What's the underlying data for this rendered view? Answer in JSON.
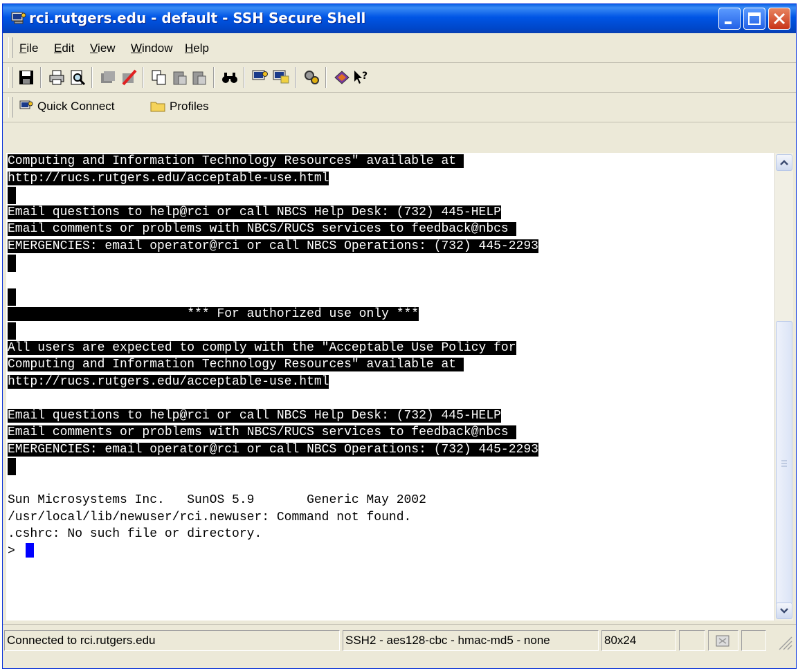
{
  "window": {
    "title": "rci.rutgers.edu - default - SSH Secure Shell"
  },
  "menus": [
    {
      "label": "File",
      "u": "F",
      "rest": "ile"
    },
    {
      "label": "Edit",
      "u": "E",
      "rest": "dit"
    },
    {
      "label": "View",
      "u": "V",
      "rest": "iew"
    },
    {
      "label": "Window",
      "u": "W",
      "rest": "indow"
    },
    {
      "label": "Help",
      "u": "H",
      "rest": "elp"
    }
  ],
  "quickbar": {
    "quick_connect": "Quick Connect",
    "profiles": "Profiles"
  },
  "terminal": {
    "lines": [
      {
        "text": "Computing and Information Technology Resources\" available at ",
        "hl": true
      },
      {
        "text": "http://rucs.rutgers.edu/acceptable-use.html",
        "hl": true
      },
      {
        "text": "",
        "hl": true
      },
      {
        "text": "Email questions to help@rci or call NBCS Help Desk: (732) 445-HELP",
        "hl": true
      },
      {
        "text": "Email comments or problems with NBCS/RUCS services to feedback@nbcs ",
        "hl": true
      },
      {
        "text": "EMERGENCIES: email operator@rci or call NBCS Operations: (732) 445-2293",
        "hl": true
      },
      {
        "text": "",
        "hl": true
      },
      {
        "text": "",
        "hl": false
      },
      {
        "text": "",
        "hl": true
      },
      {
        "text": "                        *** For authorized use only ***",
        "hl": true
      },
      {
        "text": "",
        "hl": true
      },
      {
        "text": "All users are expected to comply with the \"Acceptable Use Policy for",
        "hl": true
      },
      {
        "text": "Computing and Information Technology Resources\" available at ",
        "hl": true
      },
      {
        "text": "http://rucs.rutgers.edu/acceptable-use.html",
        "hl": true
      },
      {
        "text": "",
        "hl": false
      },
      {
        "text": "Email questions to help@rci or call NBCS Help Desk: (732) 445-HELP",
        "hl": true
      },
      {
        "text": "Email comments or problems with NBCS/RUCS services to feedback@nbcs ",
        "hl": true
      },
      {
        "text": "EMERGENCIES: email operator@rci or call NBCS Operations: (732) 445-2293",
        "hl": true
      },
      {
        "text": "",
        "hl": true
      },
      {
        "text": "",
        "hl": false
      },
      {
        "text": "Sun Microsystems Inc.   SunOS 5.9       Generic May 2002",
        "hl": false
      },
      {
        "text": "/usr/local/lib/newuser/rci.newuser: Command not found.",
        "hl": false
      },
      {
        "text": ".cshrc: No such file or directory.",
        "hl": false
      },
      {
        "text": "> ",
        "hl": false,
        "cursor": true
      }
    ]
  },
  "statusbar": {
    "connection": "Connected to rci.rutgers.edu",
    "cipher": "SSH2 - aes128-cbc - hmac-md5 - none",
    "size": "80x24"
  },
  "colors": {
    "titlebar": "#0055e5",
    "close_button": "#c8341a",
    "cursor": "#0000ff",
    "terminal_bg": "#ffffff",
    "highlight": "#000000"
  },
  "icons": [
    "ssh-app-icon",
    "minimize-icon",
    "maximize-icon",
    "close-icon",
    "save-icon",
    "print-icon",
    "print-preview-icon",
    "disconnect-icon",
    "cancel-icon",
    "copy-icon",
    "paste-icon",
    "paste-alt-icon",
    "find-icon",
    "new-terminal-icon",
    "new-file-transfer-icon",
    "settings-icon",
    "help-book-icon",
    "whats-this-icon",
    "quick-connect-icon",
    "profiles-folder-icon",
    "resize-grip-icon"
  ]
}
